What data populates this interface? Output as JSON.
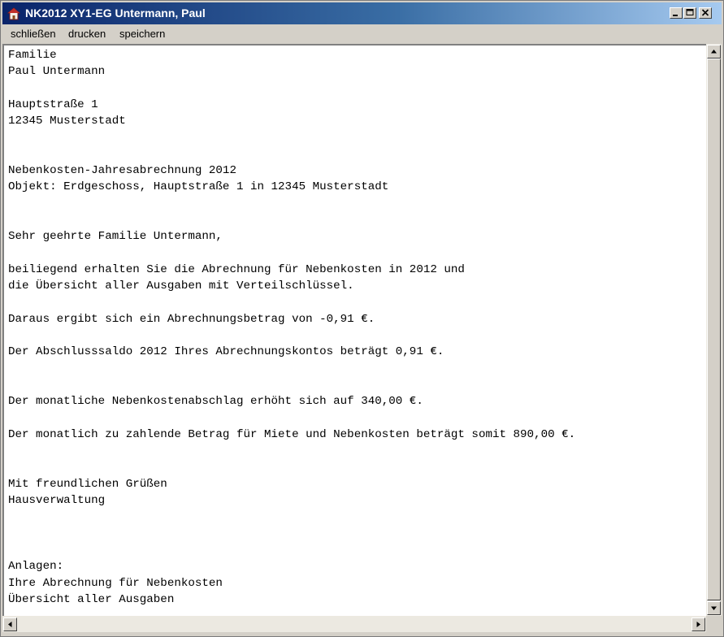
{
  "window": {
    "title": "NK2012 XY1-EG Untermann, Paul",
    "icon": "house-icon"
  },
  "menu": {
    "items": [
      "schließen",
      "drucken",
      "speichern"
    ]
  },
  "document": {
    "lines": [
      "Familie",
      "Paul Untermann",
      "",
      "Hauptstraße 1",
      "12345 Musterstadt",
      "",
      "",
      "Nebenkosten-Jahresabrechnung 2012",
      "Objekt: Erdgeschoss, Hauptstraße 1 in 12345 Musterstadt",
      "",
      "",
      "Sehr geehrte Familie Untermann,",
      "",
      "beiliegend erhalten Sie die Abrechnung für Nebenkosten in 2012 und",
      "die Übersicht aller Ausgaben mit Verteilschlüssel.",
      "",
      "Daraus ergibt sich ein Abrechnungsbetrag von -0,91 €.",
      "",
      "Der Abschlusssaldo 2012 Ihres Abrechnungskontos beträgt 0,91 €.",
      "",
      "",
      "Der monatliche Nebenkostenabschlag erhöht sich auf 340,00 €.",
      "",
      "Der monatlich zu zahlende Betrag für Miete und Nebenkosten beträgt somit 890,00 €.",
      "",
      "",
      "Mit freundlichen Grüßen",
      "Hausverwaltung",
      "",
      "",
      "",
      "Anlagen:",
      "Ihre Abrechnung für Nebenkosten",
      "Übersicht aller Ausgaben"
    ]
  },
  "colors": {
    "titlebar_start": "#0a246a",
    "titlebar_end": "#a6caf0",
    "chrome": "#d4d0c8",
    "editor_bg": "#ffffff"
  }
}
